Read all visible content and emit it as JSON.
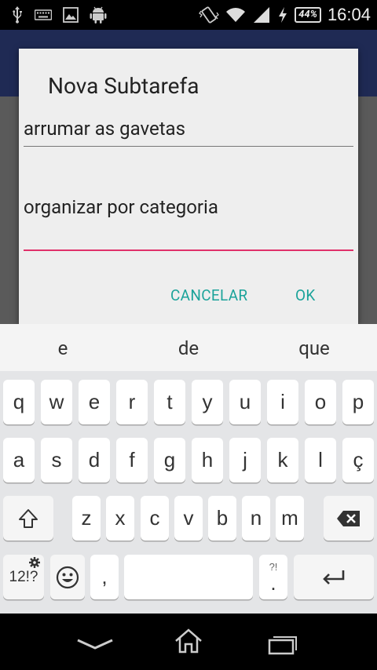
{
  "status_bar": {
    "time": "16:04",
    "battery": "44%",
    "icons": [
      "usb-icon",
      "keyboard-icon",
      "image-icon",
      "android-icon",
      "vibrate-icon",
      "wifi-icon",
      "signal-icon",
      "charging-icon"
    ]
  },
  "dialog": {
    "title": "Nova Subtarefa",
    "field1_value": "arrumar as gavetas",
    "field2_value": "organizar por categoria",
    "cancel_label": "CANCELAR",
    "ok_label": "OK"
  },
  "keyboard": {
    "suggestions": [
      "e",
      "de",
      "que"
    ],
    "row1": [
      "q",
      "w",
      "e",
      "r",
      "t",
      "y",
      "u",
      "i",
      "o",
      "p"
    ],
    "row2": [
      "a",
      "s",
      "d",
      "f",
      "g",
      "h",
      "j",
      "k",
      "l",
      "ç"
    ],
    "row3": [
      "z",
      "x",
      "c",
      "v",
      "b",
      "n",
      "m"
    ],
    "symbols_label": "12!?",
    "comma_label": ",",
    "period_label": ".",
    "period_hint": "?!"
  },
  "colors": {
    "accent": "#1ba39a",
    "active_underline": "#e0306a",
    "appbar": "#1f2a54"
  }
}
